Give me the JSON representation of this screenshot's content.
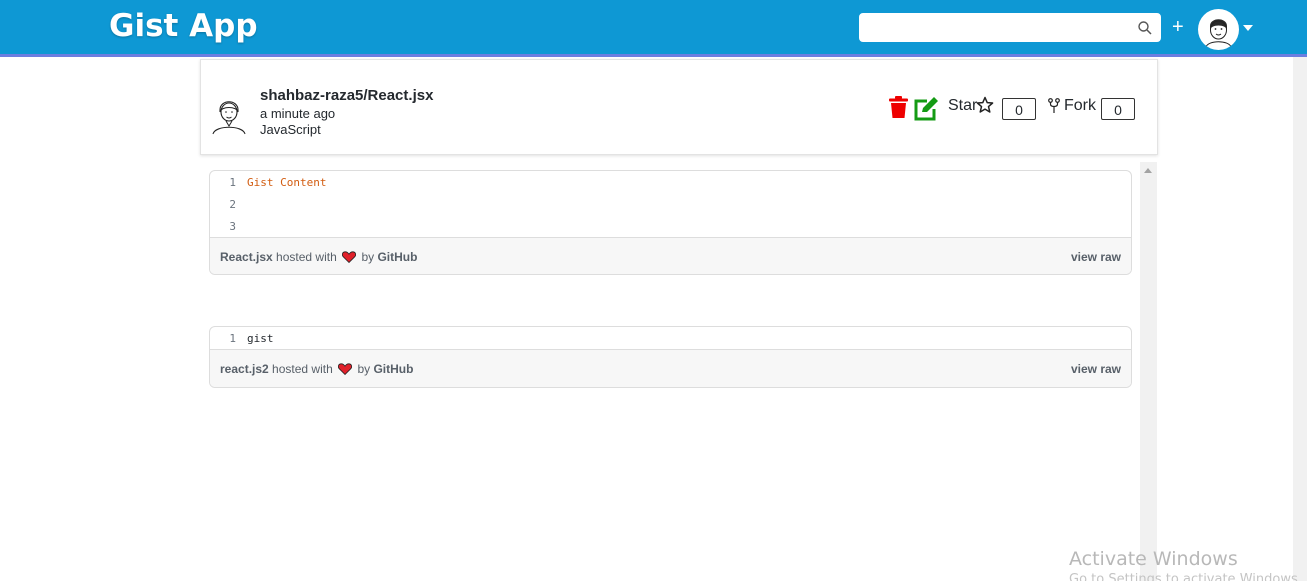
{
  "app": {
    "brand": "Gist App"
  },
  "search": {
    "value": "",
    "placeholder": ""
  },
  "header": {
    "plus": "+"
  },
  "gist": {
    "title": "shahbaz-raza5/React.jsx",
    "time": "a minute ago",
    "language": "JavaScript",
    "star_label": "Star",
    "star_count": "0",
    "fork_label": "Fork",
    "fork_count": "0"
  },
  "embeds": [
    {
      "lines": [
        {
          "num": "1",
          "code": "Gist Content"
        },
        {
          "num": "2",
          "code": ""
        },
        {
          "num": "3",
          "code": ""
        }
      ],
      "filename": "React.jsx",
      "hosted_with": "hosted with",
      "by": "by",
      "github": "GitHub",
      "view_raw": "view raw"
    },
    {
      "lines": [
        {
          "num": "1",
          "code": "gist"
        }
      ],
      "filename": "react.js2",
      "hosted_with": "hosted with",
      "by": "by",
      "github": "GitHub",
      "view_raw": "view raw"
    }
  ],
  "watermark": {
    "line1": "Activate Windows",
    "line2": "Go to Settings to activate Windows."
  },
  "colors": {
    "navbar": "#0e98d4",
    "trash": "#ee0000",
    "edit": "#149b14",
    "code_string": "#d25c10",
    "heart": "#e0202a"
  },
  "icons": [
    "search-icon",
    "plus-icon",
    "user-avatar-icon",
    "caret-down-icon",
    "trash-icon",
    "edit-icon",
    "star-icon",
    "fork-icon",
    "heart-icon"
  ]
}
